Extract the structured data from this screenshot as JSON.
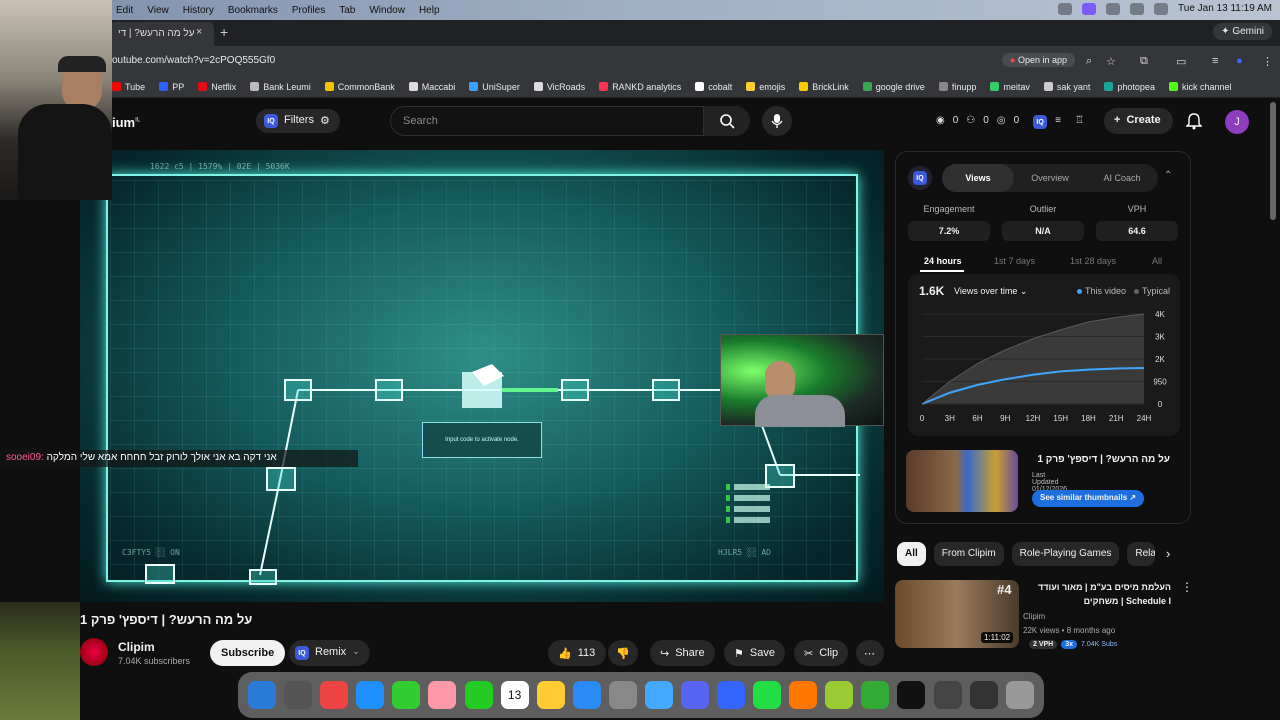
{
  "menubar": {
    "items": [
      "Edit",
      "View",
      "History",
      "Bookmarks",
      "Profiles",
      "Tab",
      "Window",
      "Help"
    ],
    "clock": "Tue Jan 13  11:19 AM"
  },
  "browser": {
    "tab_title": "על מה הרעש? | די",
    "tab_close": "×",
    "new_tab": "+",
    "gemini": "Gemini",
    "url": "outube.com/watch?v=2cPOQ555Gf0",
    "open_in_app": "Open in app"
  },
  "bookmarks": [
    {
      "label": "Tube",
      "color": "#ff0000"
    },
    {
      "label": "PP",
      "color": "#2a62ff"
    },
    {
      "label": "Netflix",
      "color": "#e50914"
    },
    {
      "label": "Bank Leumi",
      "color": "#bbbbbb"
    },
    {
      "label": "CommonBank",
      "color": "#f5c400"
    },
    {
      "label": "Maccabi",
      "color": "#dddddd"
    },
    {
      "label": "UniSuper",
      "color": "#3aa0ff"
    },
    {
      "label": "VicRoads",
      "color": "#dddddd"
    },
    {
      "label": "RANKD analytics",
      "color": "#ff3355"
    },
    {
      "label": "cobalt",
      "color": "#ffffff"
    },
    {
      "label": "emojis",
      "color": "#ffcc33"
    },
    {
      "label": "BrickLink",
      "color": "#ffcc00"
    },
    {
      "label": "google drive",
      "color": "#34a853"
    },
    {
      "label": "finupp",
      "color": "#888888"
    },
    {
      "label": "meitav",
      "color": "#33cc66"
    },
    {
      "label": "sak yant",
      "color": "#cccccc"
    },
    {
      "label": "photopea",
      "color": "#18a497"
    },
    {
      "label": "kick channel",
      "color": "#53fc18"
    }
  ],
  "header": {
    "logo": "ium",
    "logo_sup": "IL",
    "filters": "Filters",
    "search_placeholder": "Search",
    "stat_a": "0",
    "stat_b": "0",
    "stat_c": "0",
    "create": "Create",
    "avatar_letter": "J"
  },
  "video": {
    "hud_top": "1622 c5  |  1579%  |  02E  |  5036K",
    "node_hint": "Input code to activate node.",
    "hud_bl": "C3FTY5  ░░  ON",
    "hud_br": "HJLR5  ░░  AD",
    "chat_user": "sooei09:",
    "chat_msg": "אני דקה בא אני אולך לורוק זבל חחחח אמא שלי המלקה"
  },
  "title": {
    "text": "על מה הרעש? | דיספץ' פרק 1",
    "channel": "Clipim",
    "subs": "7.04K subscribers",
    "subscribe": "Subscribe",
    "remix": "Remix",
    "likes": "113",
    "share": "Share",
    "save": "Save",
    "clip": "Clip"
  },
  "iq_panel": {
    "tabs": [
      "Views",
      "Overview",
      "AI Coach"
    ],
    "metrics": [
      {
        "label": "Engagement",
        "value": "7.2%"
      },
      {
        "label": "Outlier",
        "value": "N/A"
      },
      {
        "label": "VPH",
        "value": "64.6"
      }
    ],
    "ranges": [
      "24 hours",
      "1st 7 days",
      "1st 28 days",
      "All"
    ],
    "views_total": "1.6K",
    "views_over": "Views over time ⌄",
    "legend_this": "This video",
    "legend_typical": "Typical",
    "thumb_title": "על מה הרעש? | דיספץ' פרק 1",
    "thumb_updated": "Last Updated 01/12/2026",
    "similar": "See similar thumbnails ↗"
  },
  "chart_data": {
    "type": "area",
    "x_ticks": [
      "0",
      "3H",
      "6H",
      "9H",
      "12H",
      "15H",
      "18H",
      "21H",
      "24H"
    ],
    "y_ticks": [
      "4K",
      "3K",
      "2K",
      "950",
      "0"
    ],
    "series": [
      {
        "name": "This video",
        "x": [
          0,
          3,
          6,
          9,
          12,
          15,
          18,
          21,
          24
        ],
        "values": [
          0,
          500,
          850,
          1100,
          1300,
          1450,
          1530,
          1580,
          1600
        ],
        "color": "#3ea6ff"
      },
      {
        "name": "Typical",
        "x": [
          0,
          3,
          6,
          9,
          12,
          15,
          18,
          21,
          24
        ],
        "values": [
          0,
          1000,
          1800,
          2400,
          2900,
          3300,
          3650,
          3850,
          4000
        ],
        "color": "#5a5a5a"
      }
    ]
  },
  "chips": [
    "All",
    "From Clipim",
    "Role-Playing Games",
    "Rela"
  ],
  "rec": {
    "rank": "#4",
    "title": "העלמת מיסים בע\"מ | מאור ועודד Schedule I | משחקים",
    "channel": "Clipim",
    "views": "22K views • 8 months ago",
    "duration": "1:11:02",
    "vph": "2 VPH",
    "mult": "3x",
    "subs": "7.04K Subs"
  },
  "dock": [
    "Finder",
    "Launchpad",
    "Chrome",
    "Safari",
    "Messages",
    "Photos",
    "FaceTime",
    "Calendar",
    "Notes",
    "App Store",
    "Settings",
    "Files",
    "Discord",
    "Arc",
    "WhatsApp",
    "Firefox",
    "Vectorworks",
    "Google Drive",
    "CapCut",
    "OBS",
    "Minecraft",
    "Trash"
  ],
  "calendar_day": "13"
}
